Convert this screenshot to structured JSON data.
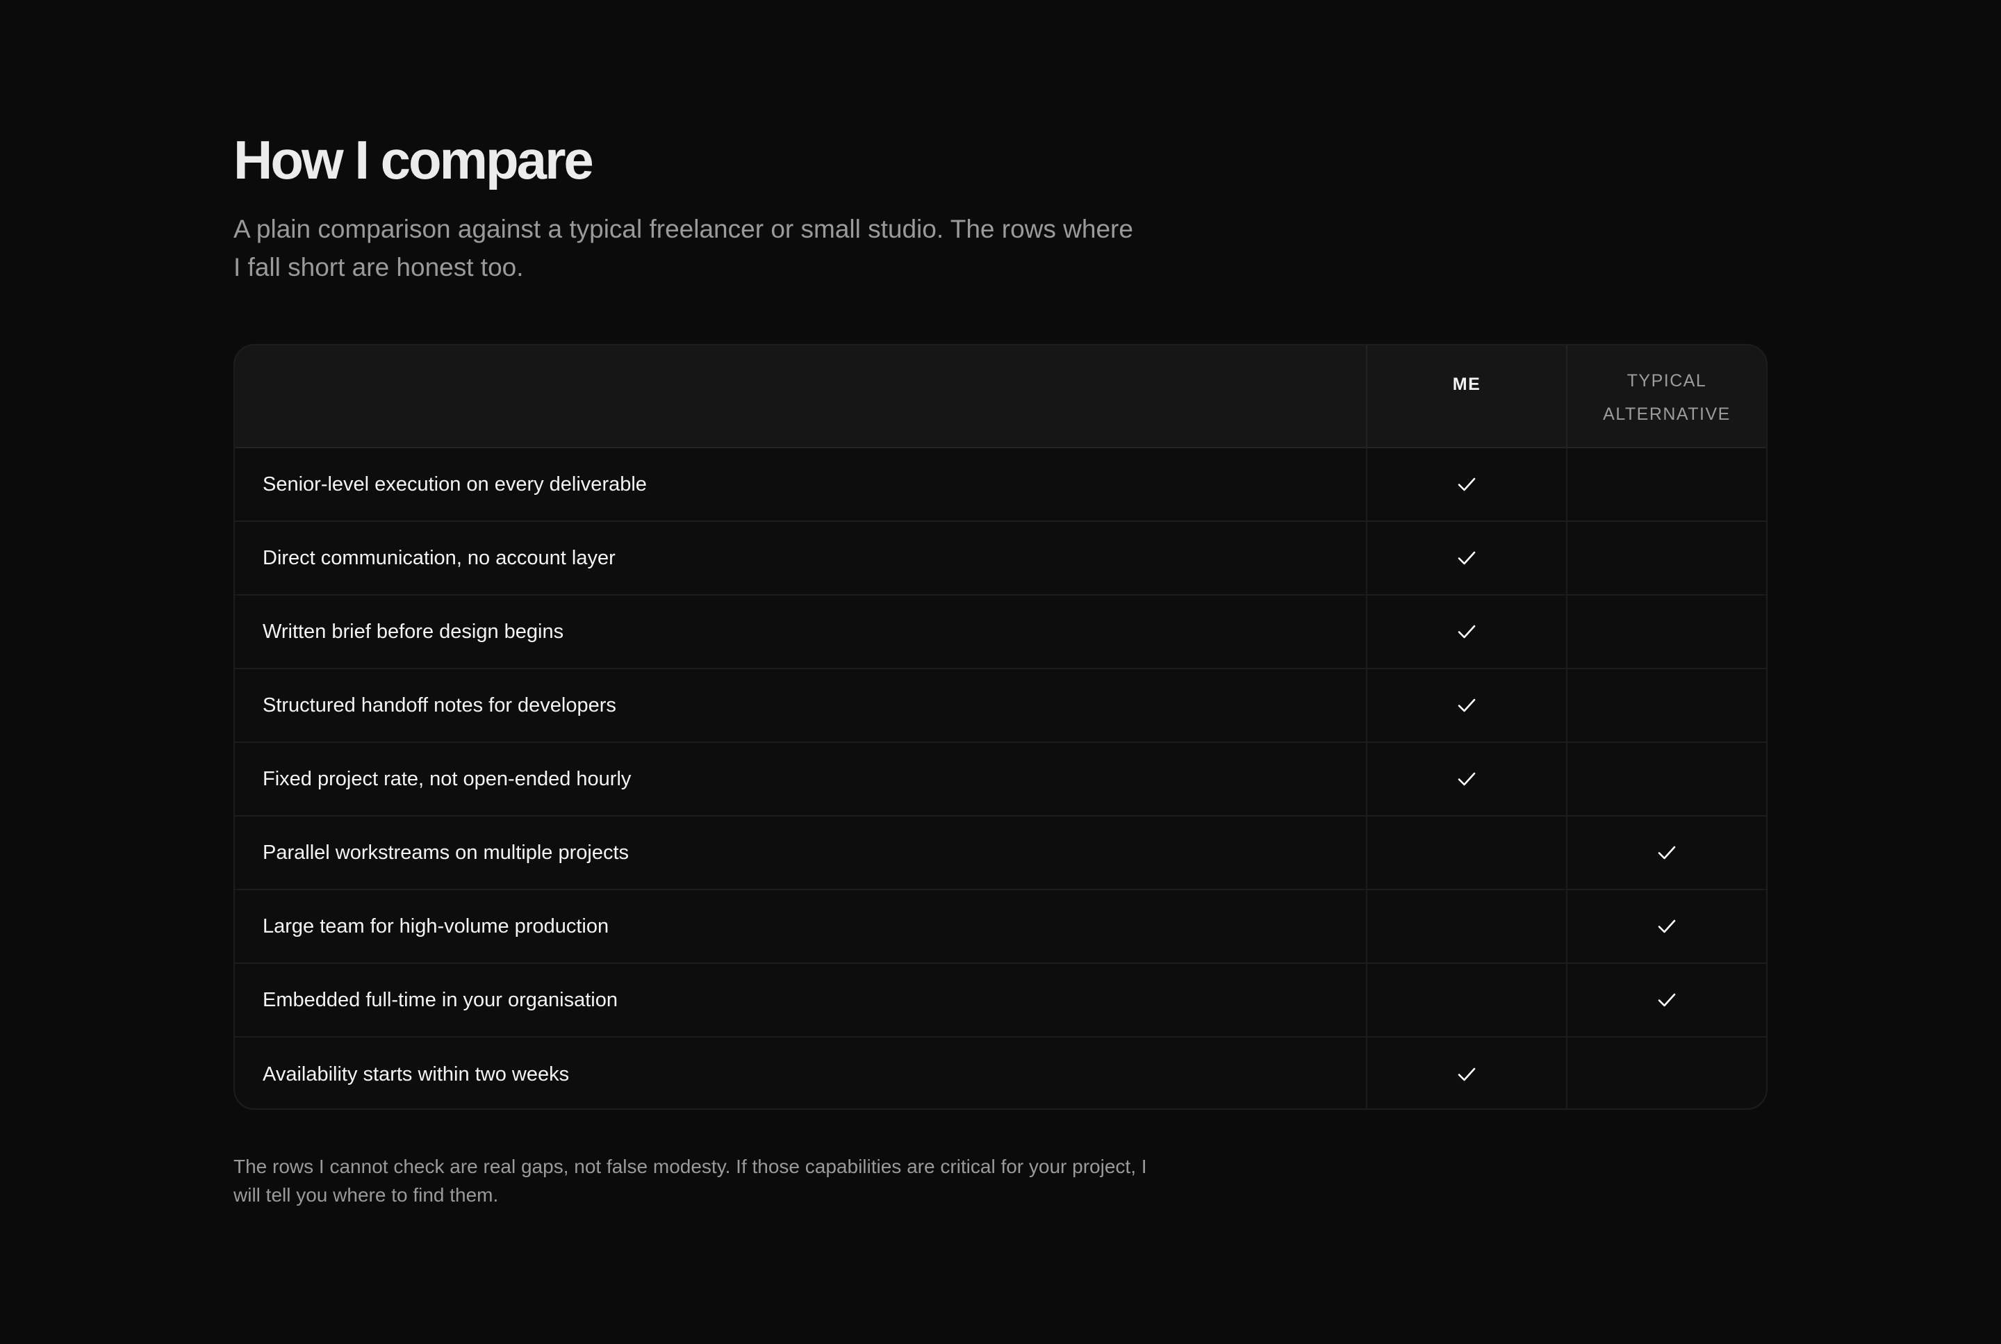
{
  "heading": {
    "title": "How I compare",
    "subtitle": "A plain comparison against a typical freelancer or small studio. The rows where I fall short are honest too."
  },
  "table": {
    "columns": {
      "me": "ME",
      "alt_line1": "TYPICAL",
      "alt_line2": "ALTERNATIVE"
    },
    "rows": [
      {
        "label": "Senior-level execution on every deliverable",
        "me": "check-icon",
        "alt": "dash-icon"
      },
      {
        "label": "Direct communication, no account layer",
        "me": "check-icon",
        "alt": "dash-icon"
      },
      {
        "label": "Written brief before design begins",
        "me": "check-icon",
        "alt": "dash-icon"
      },
      {
        "label": "Structured handoff notes for developers",
        "me": "check-icon",
        "alt": "dash-icon"
      },
      {
        "label": "Fixed project rate, not open-ended hourly",
        "me": "check-icon",
        "alt": "dash-icon"
      },
      {
        "label": "Parallel workstreams on multiple projects",
        "me": "dash-icon",
        "alt": "check-icon"
      },
      {
        "label": "Large team for high-volume production",
        "me": "dash-icon",
        "alt": "check-icon"
      },
      {
        "label": "Embedded full-time in your organisation",
        "me": "dash-icon",
        "alt": "check-icon"
      },
      {
        "label": "Availability starts within two weeks",
        "me": "check-icon",
        "alt": "dash-icon"
      }
    ]
  },
  "footnote": "The rows I cannot check are real gaps, not false modesty. If those capabilities are critical for your project, I will tell you where to find them.",
  "colors": {
    "background": "#0b0b0b",
    "header_row": "#161616",
    "text_primary": "#f4f4f4",
    "text_muted": "#9a9a9a",
    "check": "#ffffff",
    "dash": "#3a3a3a"
  }
}
